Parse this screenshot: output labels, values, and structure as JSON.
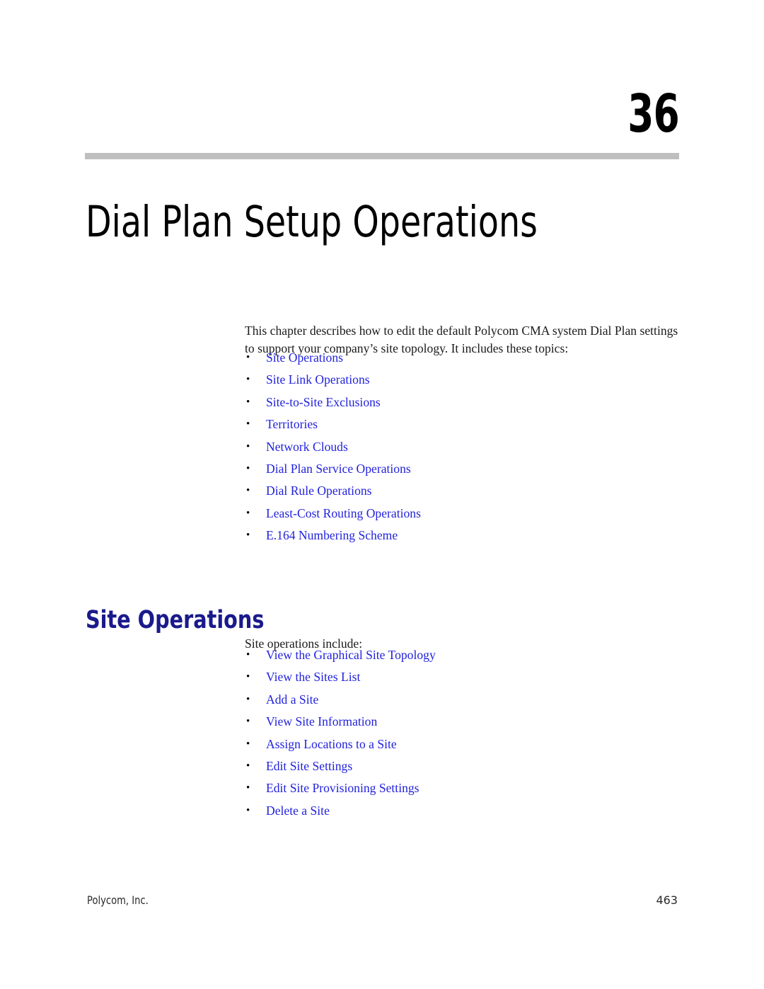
{
  "chapter": {
    "number": "36",
    "title": "Dial Plan Setup Operations",
    "rule_color": "#bfbfbf"
  },
  "intro": {
    "paragraph": "This chapter describes how to edit the default Polycom CMA system Dial Plan settings to support your company’s site topology. It includes these topics:"
  },
  "topics": {
    "bullet_glyph": "•",
    "link_color": "#2222dd",
    "items": [
      {
        "label": "Site Operations"
      },
      {
        "label": "Site Link Operations"
      },
      {
        "label": "Site-to-Site Exclusions"
      },
      {
        "label": "Territories"
      },
      {
        "label": "Network Clouds"
      },
      {
        "label": "Dial Plan Service Operations"
      },
      {
        "label": "Dial Rule Operations"
      },
      {
        "label": "Least-Cost Routing Operations"
      },
      {
        "label": "E.164 Numbering Scheme"
      }
    ]
  },
  "section": {
    "heading": "Site Operations",
    "heading_color": "#1a1a8c",
    "intro": "Site operations include:",
    "items": [
      {
        "label": "View the Graphical Site Topology"
      },
      {
        "label": "View the Sites List"
      },
      {
        "label": "Add a Site"
      },
      {
        "label": "View Site Information"
      },
      {
        "label": "Assign Locations to a Site"
      },
      {
        "label": "Edit Site Settings"
      },
      {
        "label": "Edit Site Provisioning Settings"
      },
      {
        "label": "Delete a Site"
      }
    ]
  },
  "footer": {
    "company": "Polycom, Inc.",
    "page_number": "463"
  }
}
